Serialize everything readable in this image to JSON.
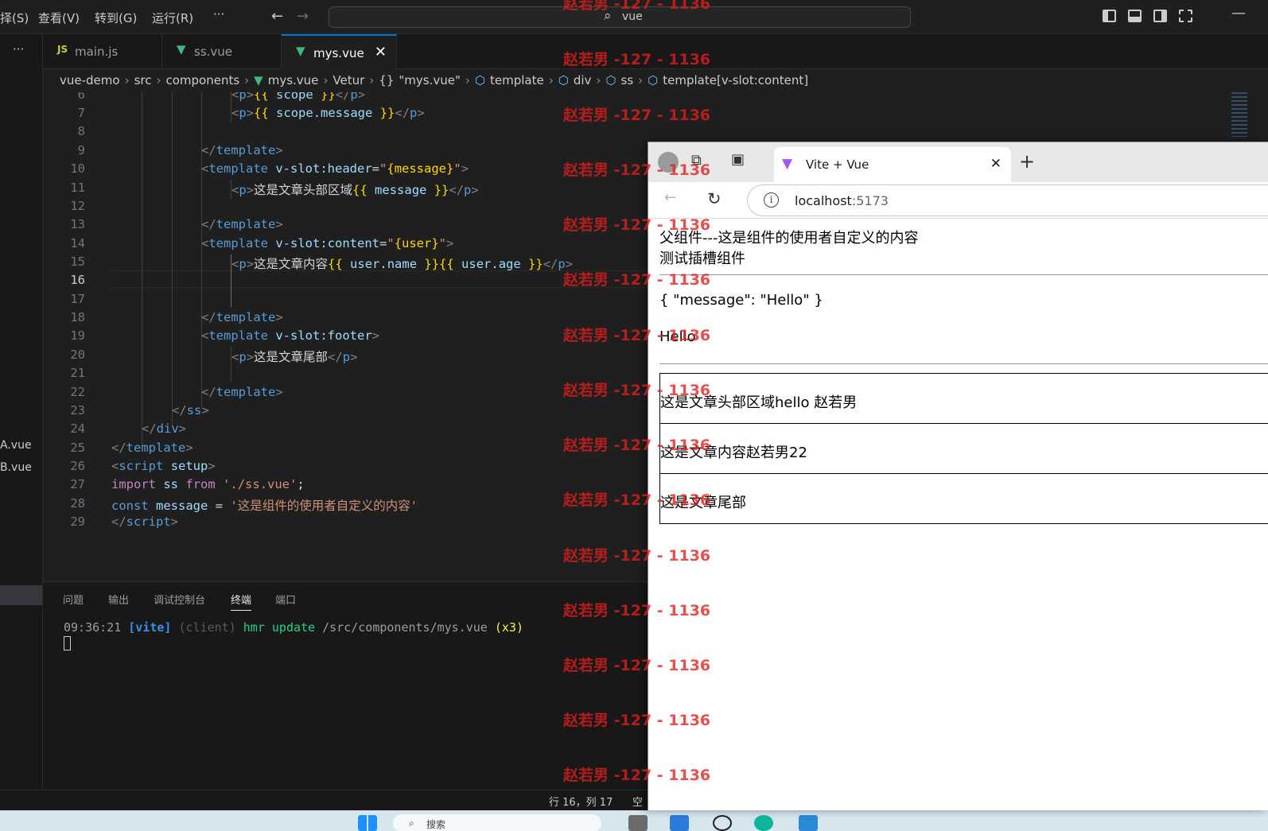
{
  "titlebar": {
    "menu": [
      "择(S)",
      "查看(V)",
      "转到(G)",
      "运行(R)",
      "···"
    ],
    "search": "vue"
  },
  "tabs": [
    {
      "icon": "JS",
      "label": "main.js"
    },
    {
      "icon": "V",
      "label": "ss.vue"
    },
    {
      "icon": "V",
      "label": "mys.vue",
      "close": "✕"
    }
  ],
  "breadcrumb": [
    "vue-demo",
    "src",
    "components",
    "mys.vue",
    "Vetur",
    "\"mys.vue\"",
    "template",
    "div",
    "ss",
    "template[v-slot:content]"
  ],
  "sidebar": {
    "more": "···",
    "files": [
      "A.vue",
      "B.vue"
    ]
  },
  "editor": {
    "current_line": 16,
    "lines": [
      {
        "n": "6"
      },
      {
        "n": "7"
      },
      {
        "n": "8"
      },
      {
        "n": "9"
      },
      {
        "n": "10"
      },
      {
        "n": "11"
      },
      {
        "n": "12"
      },
      {
        "n": "13"
      },
      {
        "n": "14"
      },
      {
        "n": "15"
      },
      {
        "n": "16"
      },
      {
        "n": "17"
      },
      {
        "n": "18"
      },
      {
        "n": "19"
      },
      {
        "n": "20"
      },
      {
        "n": "21"
      },
      {
        "n": "22"
      },
      {
        "n": "23"
      },
      {
        "n": "24"
      },
      {
        "n": "25"
      },
      {
        "n": "26"
      },
      {
        "n": "27"
      },
      {
        "n": "28"
      },
      {
        "n": "29"
      }
    ],
    "tokens": {
      "p": "p",
      "template": "template",
      "ss": "ss",
      "div": "div",
      "script": "script",
      "setup": "setup",
      "scope": "scope",
      "scope_message": "scope.message",
      "v_slot_header": "v-slot:header",
      "v_slot_content": "v-slot:content",
      "v_slot_footer": "v-slot:footer",
      "header_val": "{message}",
      "content_val": "{user}",
      "message": "message",
      "user_name": "user.name",
      "user_age": "user.age",
      "txt_header": "这是文章头部区域",
      "txt_content": "这是文章内容",
      "txt_footer": "这是文章尾部",
      "import": "import",
      "from": "from",
      "import_path": "'./ss.vue'",
      "const": "const",
      "const_val": "'这是组件的使用者自定义的内容'"
    }
  },
  "panel": {
    "tabs": [
      "问题",
      "输出",
      "调试控制台",
      "终端",
      "端口"
    ],
    "active_tab": "终端",
    "terminal": {
      "time": "09:36:21",
      "tag": "[vite]",
      "client": "(client)",
      "msg": "hmr update",
      "path": "/src/components/mys.vue",
      "count": "(x3)"
    }
  },
  "statusbar": {
    "position": "行 16，列 17",
    "spaces": "空"
  },
  "taskbar": {
    "search": "搜索"
  },
  "browser": {
    "tab_title": "Vite + Vue",
    "url_host": "localhost",
    "url_port": ":5173",
    "content": {
      "line1": "父组件---这是组件的使用者自定义的内容",
      "line2": "测试插槽组件",
      "json": "{ \"message\": \"Hello\" }",
      "hello": "Hello",
      "header": "这是文章头部区域hello 赵若男",
      "body": "这是文章内容赵若男22",
      "footer": "这是文章尾部"
    }
  },
  "watermark": "赵若男 -127 - 1136"
}
